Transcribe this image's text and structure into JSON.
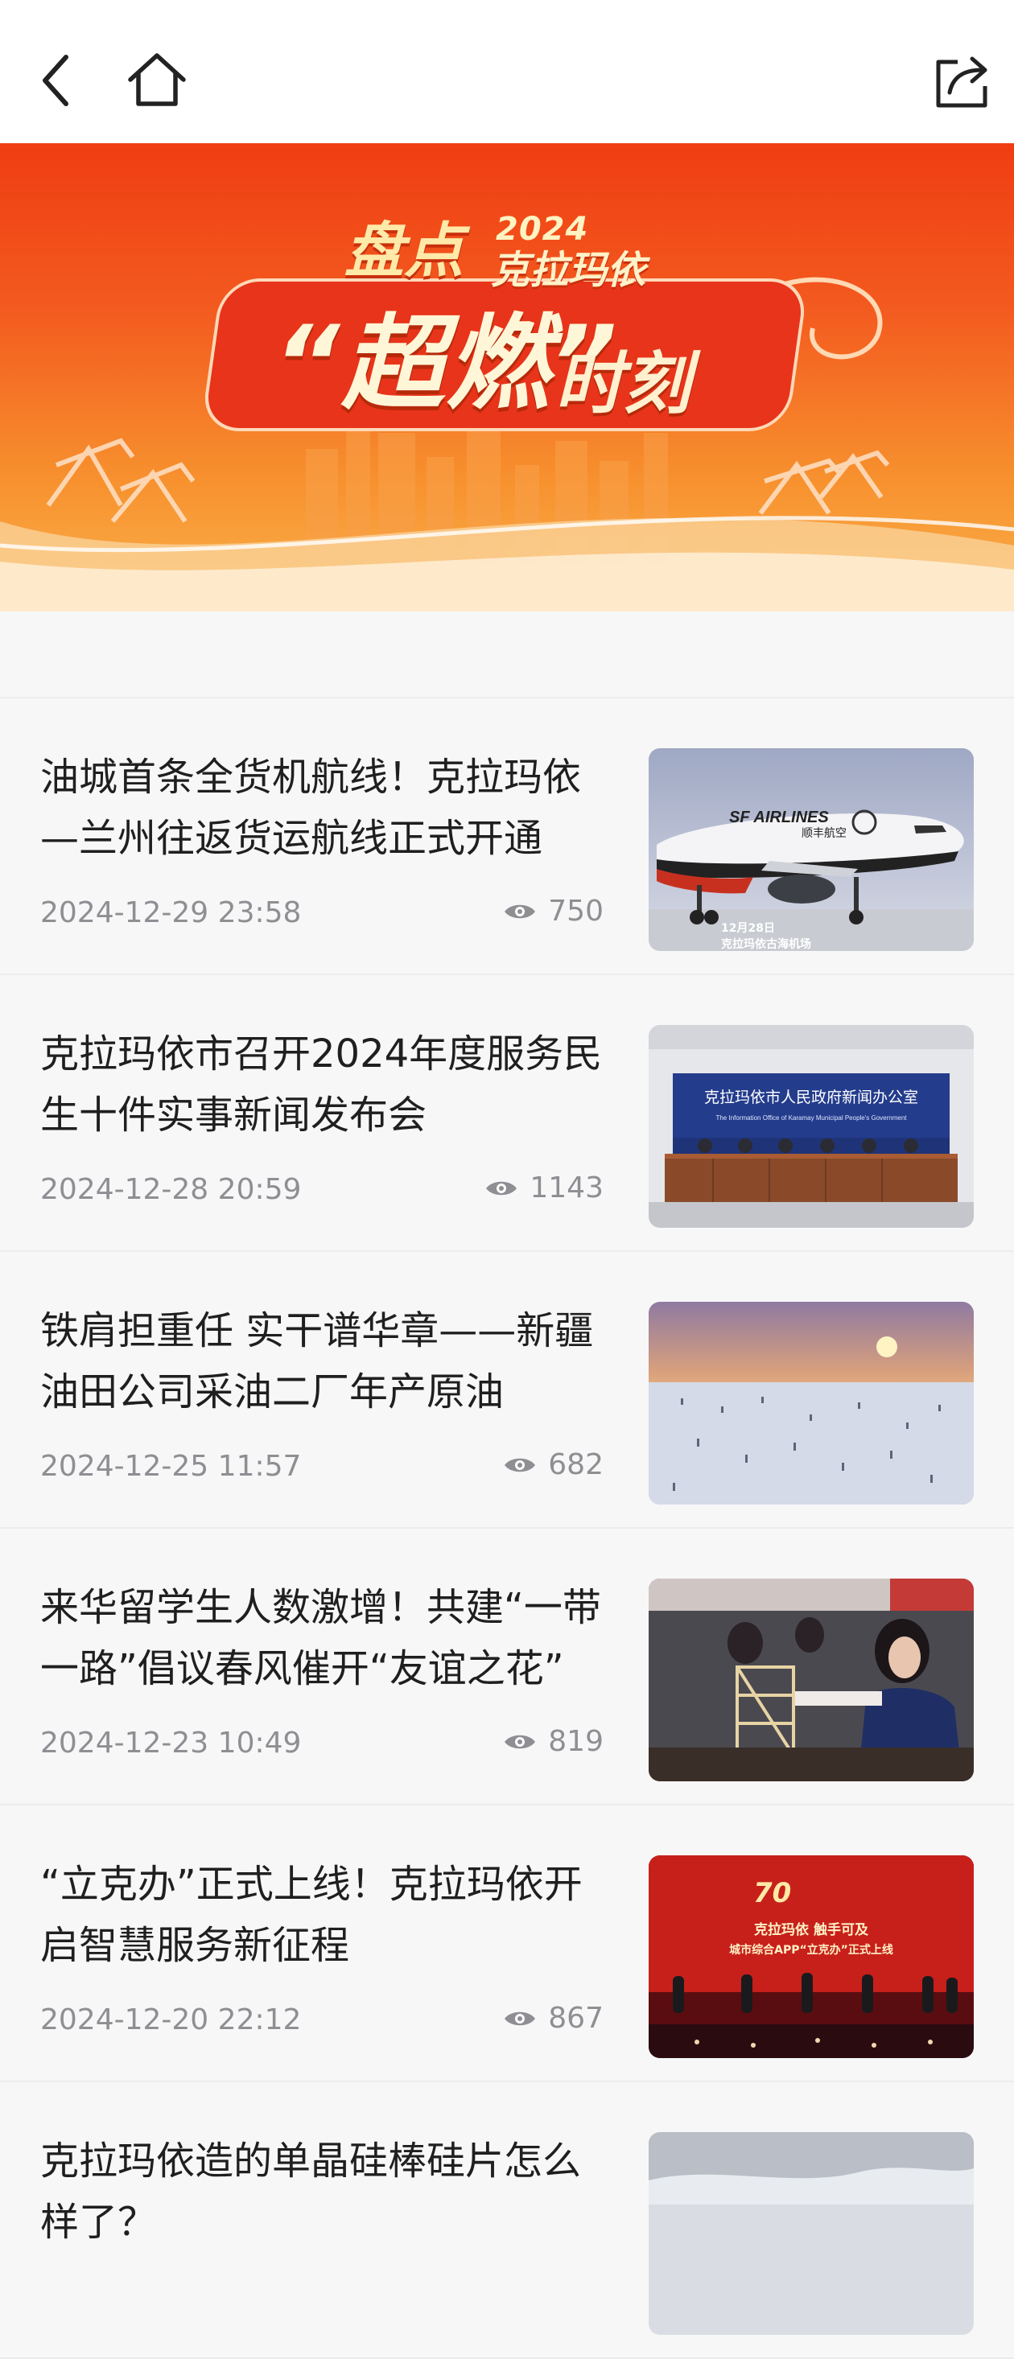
{
  "nav": {
    "back_icon": "chevron-left-icon",
    "home_icon": "home-icon",
    "share_icon": "share-icon"
  },
  "banner": {
    "year": "2024",
    "line1": "盘点",
    "city": "克拉玛依",
    "main": "“超燃”",
    "tail": "时刻"
  },
  "articles": [
    {
      "title": "油城首条全货机航线！克拉玛依—兰州往返货运航线正式开通",
      "date": "2024-12-29 23:58",
      "views": "750",
      "thumb": {
        "brand": "SF AIRLINES",
        "brand_cn": "顺丰航空",
        "caption_line1": "12月28日",
        "caption_line2": "克拉玛依古海机场"
      }
    },
    {
      "title": "克拉玛依市召开2024年度服务民生十件实事新闻发布会",
      "date": "2024-12-28 20:59",
      "views": "1143",
      "thumb": {
        "banner_cn": "克拉玛依市人民政府新闻办公室",
        "banner_en": "The Information Office of Karamay Municipal People's Government"
      }
    },
    {
      "title": "铁肩担重任 实干谱华章——新疆油田公司采油二厂年产原油",
      "date": "2024-12-25 11:57",
      "views": "682",
      "thumb": {}
    },
    {
      "title": "来华留学生人数激增！共建“一带一路”倡议春风催开“友谊之花”",
      "date": "2024-12-23 10:49",
      "views": "819",
      "thumb": {}
    },
    {
      "title": "“立克办”正式上线！克拉玛依开启智慧服务新征程",
      "date": "2024-12-20 22:12",
      "views": "867",
      "thumb": {
        "screen_line1": "克拉玛依 触手可及",
        "screen_line2": "城市综合APP“立克办”正式上线"
      }
    },
    {
      "title": "克拉玛依造的单晶硅棒硅片怎么样了？",
      "date": "",
      "views": "",
      "thumb": {}
    }
  ]
}
